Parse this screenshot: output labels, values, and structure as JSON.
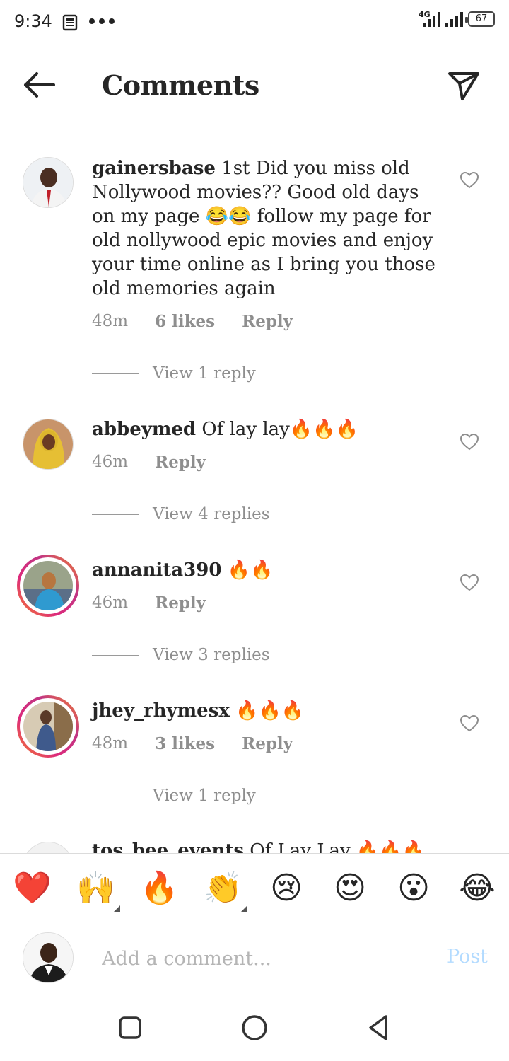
{
  "status_bar": {
    "time": "9:34",
    "network": "4G",
    "battery": "67"
  },
  "header": {
    "title": "Comments",
    "back_icon": "back-arrow-icon",
    "send_icon": "send-icon"
  },
  "comments": [
    {
      "username": "gainersbase",
      "text": "1st Did you miss old Nollywood movies?? Good old days on my page 😂😂 follow my page for old nollywood epic movies and enjoy your time online as I bring you those old memories again",
      "time": "48m",
      "likes": "6 likes",
      "reply": "Reply",
      "view_replies": "View 1 reply"
    },
    {
      "username": "abbeymed",
      "text": "Of lay lay🔥🔥🔥",
      "time": "46m",
      "likes": "",
      "reply": "Reply",
      "view_replies": "View 4 replies"
    },
    {
      "username": "annanita390",
      "text": "🔥🔥",
      "time": "46m",
      "likes": "",
      "reply": "Reply",
      "view_replies": "View 3 replies"
    },
    {
      "username": "jhey_rhymesx",
      "text": "🔥🔥🔥",
      "time": "48m",
      "likes": "3 likes",
      "reply": "Reply",
      "view_replies": "View 1 reply"
    },
    {
      "username": "tos_bee_events",
      "text": "Of Lay Lay 🔥🔥🔥"
    }
  ],
  "emoji_bar": [
    "❤️",
    "🙌",
    "🔥",
    "👏",
    "😢",
    "😍",
    "😮",
    "😂"
  ],
  "composer": {
    "placeholder": "Add a comment...",
    "post_label": "Post"
  },
  "colors": {
    "text": "#262626",
    "muted": "#8e8e8e",
    "post_disabled": "#b3dbff"
  }
}
